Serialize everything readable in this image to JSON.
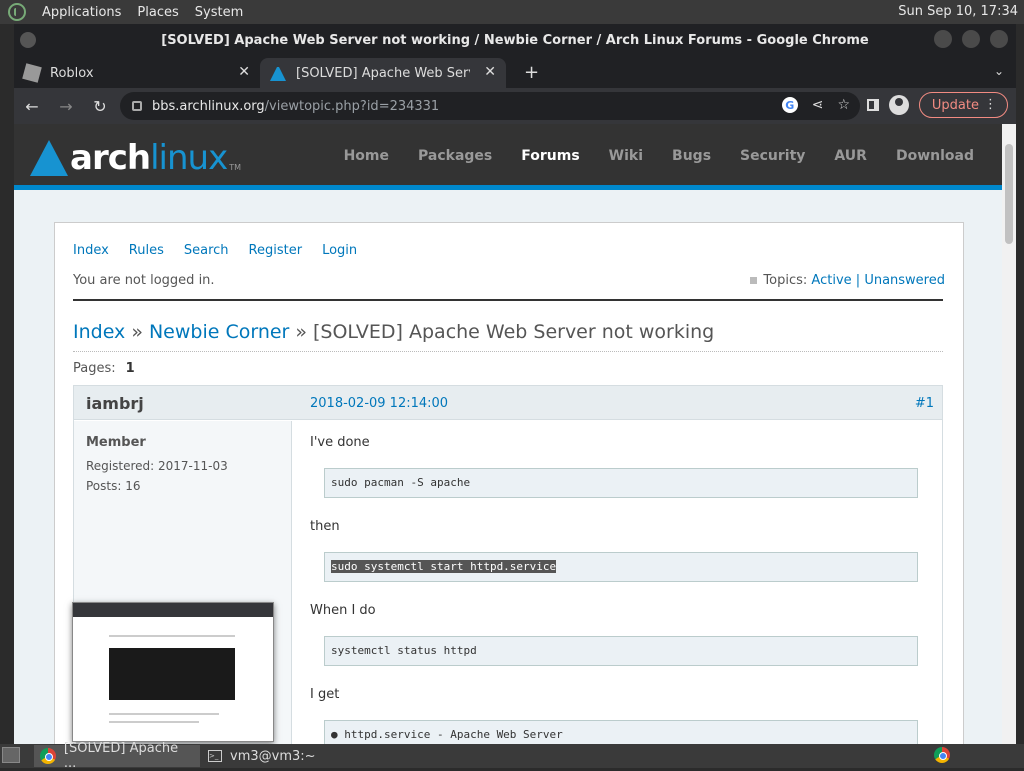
{
  "desktop": {
    "menu": [
      "Applications",
      "Places",
      "System"
    ],
    "clock": "Sun Sep 10, 17:34"
  },
  "window": {
    "title": "[SOLVED] Apache Web Server not working / Newbie Corner / Arch Linux Forums - Google Chrome"
  },
  "tabs": [
    {
      "label": "Roblox"
    },
    {
      "label": "[SOLVED] Apache Web Server"
    }
  ],
  "omnibox": {
    "host": "bbs.archlinux.org",
    "path": "/viewtopic.php?id=234331"
  },
  "toolbar": {
    "update_label": "Update"
  },
  "arch": {
    "logo_arch": "arch",
    "logo_linux": "linux",
    "logo_tm": "TM",
    "nav": [
      "Home",
      "Packages",
      "Forums",
      "Wiki",
      "Bugs",
      "Security",
      "AUR",
      "Download"
    ],
    "active_nav": "Forums"
  },
  "forum": {
    "links": [
      "Index",
      "Rules",
      "Search",
      "Register",
      "Login"
    ],
    "not_logged": "You are not logged in.",
    "topics_label": "Topics:",
    "topics_active": "Active",
    "topics_sep": "|",
    "topics_unanswered": "Unanswered",
    "crumb_index": "Index",
    "crumb_forum": "Newbie Corner",
    "crumb_sep": "»",
    "crumb_topic": "[SOLVED] Apache Web Server not working",
    "pages_label": "Pages:",
    "pages_value": "1"
  },
  "post": {
    "author": "iambrj",
    "date": "2018-02-09 12:14:00",
    "number": "#1",
    "role": "Member",
    "registered": "Registered: 2017-11-03",
    "posts": "Posts: 16",
    "text1": "I've done",
    "code1": "sudo pacman -S apache",
    "text2": "then",
    "code2": "sudo systemctl start httpd.service",
    "text3": "When I do",
    "code3": "systemctl status httpd",
    "text4": "I get",
    "code4": "● httpd.service - Apache Web Server"
  },
  "taskbar": {
    "chrome_task": "[SOLVED] Apache ...",
    "term_task": "vm3@vm3:~"
  }
}
